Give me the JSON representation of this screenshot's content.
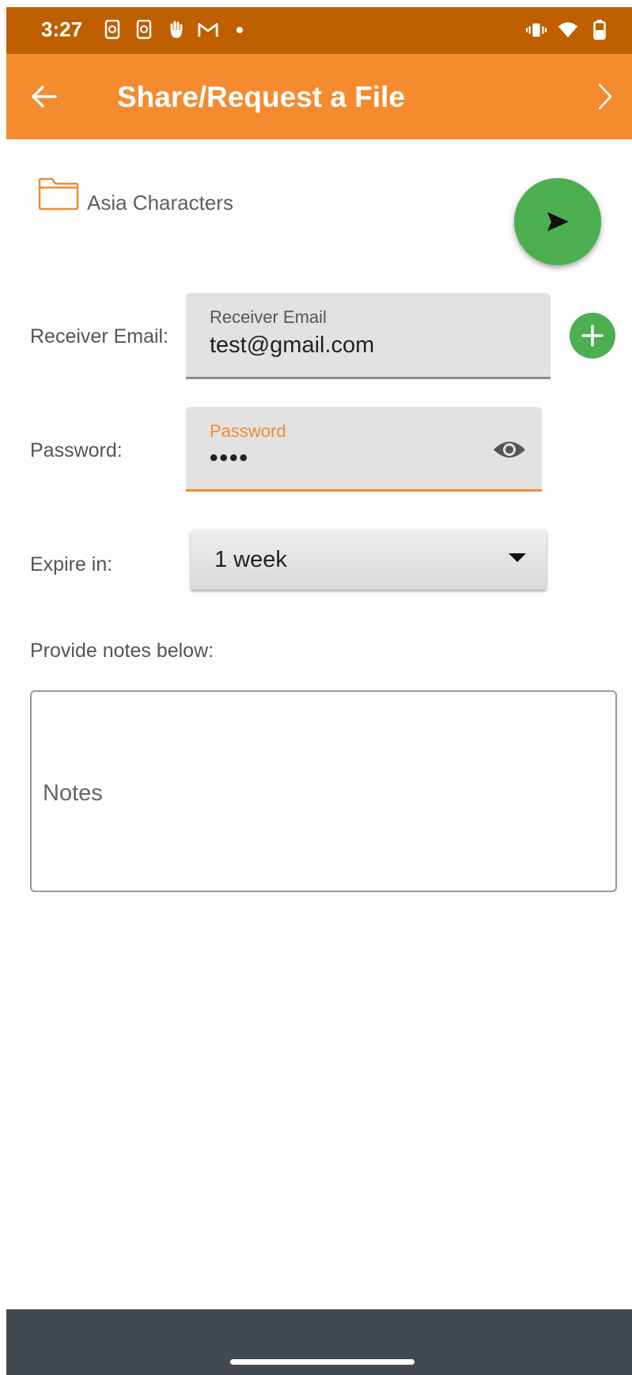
{
  "status_bar": {
    "time": "3:27",
    "left_icons": [
      "phone-sync-icon",
      "phone-sync-icon",
      "hand-icon",
      "gmail-icon",
      "dot-icon"
    ],
    "right_icons": [
      "vibrate-icon",
      "wifi-icon",
      "battery-icon"
    ]
  },
  "app_bar": {
    "title": "Share/Request a File",
    "color": "#f58b2f",
    "status_color": "#bf5f00"
  },
  "folder": {
    "name": "Asia Characters"
  },
  "form": {
    "email_row_label": "Receiver Email:",
    "email_field_label": "Receiver Email",
    "email_value": "test@gmail.com",
    "password_row_label": "Password:",
    "password_field_label": "Password",
    "password_value": "••••",
    "expire_row_label": "Expire in:",
    "expire_value": "1 week",
    "notes_label": "Provide notes below:",
    "notes_placeholder": "Notes"
  },
  "colors": {
    "accent": "#f58b2f",
    "fab": "#4caf50"
  }
}
